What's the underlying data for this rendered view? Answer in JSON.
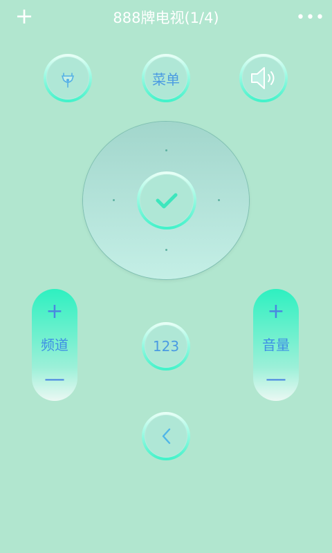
{
  "header": {
    "title": "888牌电视(1/4)",
    "add_icon": "plus-icon",
    "more_icon": "more-dots-icon"
  },
  "buttons": {
    "power_icon": "power-plug-icon",
    "menu_label": "菜单",
    "mute_icon": "speaker-mute-icon",
    "ok_icon": "checkmark-icon",
    "numbers_label": "123",
    "back_icon": "back-chevron-icon"
  },
  "channel": {
    "label": "频道",
    "plus": "+",
    "minus": "—"
  },
  "volume": {
    "label": "音量",
    "plus": "+",
    "minus": "—"
  },
  "colors": {
    "background": "#b1e6cf",
    "accent": "#3ff2c9",
    "text_blue": "#4a9be2"
  }
}
